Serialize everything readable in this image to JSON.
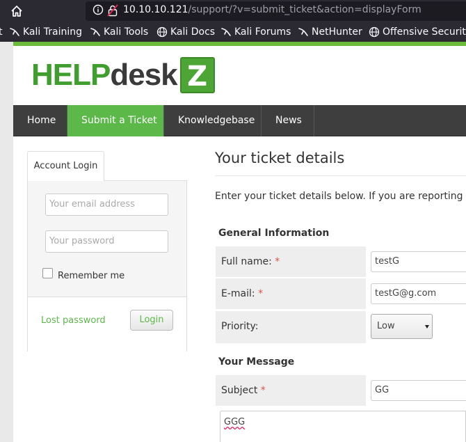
{
  "browser": {
    "url_host": "10.10.10.121",
    "url_path": "/support/?v=submit_ticket&action=displayForm",
    "bookmarks": [
      "Kali Training",
      "Kali Tools",
      "Kali Docs",
      "Kali Forums",
      "NetHunter",
      "Offensive Security"
    ],
    "bookmark_icons": [
      "kali-dragon-icon",
      "kali-dragon-icon",
      "globe-icon",
      "kali-dragon-icon",
      "kali-dragon-icon",
      "globe-icon"
    ]
  },
  "logo": {
    "part1": "Help",
    "part2": "Desk",
    "badge": "Z"
  },
  "nav": {
    "items": [
      "Home",
      "Submit a Ticket",
      "Knowledgebase",
      "News"
    ],
    "active": "Submit a Ticket"
  },
  "login": {
    "tab_label": "Account Login",
    "email_placeholder": "Your email address",
    "password_placeholder": "Your password",
    "remember_label": "Remember me",
    "lost_password": "Lost password",
    "login_button": "Login"
  },
  "ticket": {
    "title": "Your ticket details",
    "intro": "Enter your ticket details below. If you are reporting a prob",
    "general_heading": "General Information",
    "fullname_label": "Full name:",
    "fullname_value": "testG",
    "email_label": "E-mail:",
    "email_value": "testG@g.com",
    "priority_label": "Priority:",
    "priority_value": "Low",
    "message_heading": "Your Message",
    "subject_label": "Subject",
    "subject_value": "GG",
    "message_value": "GGG",
    "required_mark": "*"
  },
  "colors": {
    "accent": "#5bb849",
    "nav_bg": "#3e3e3e",
    "required": "#d9534f"
  }
}
